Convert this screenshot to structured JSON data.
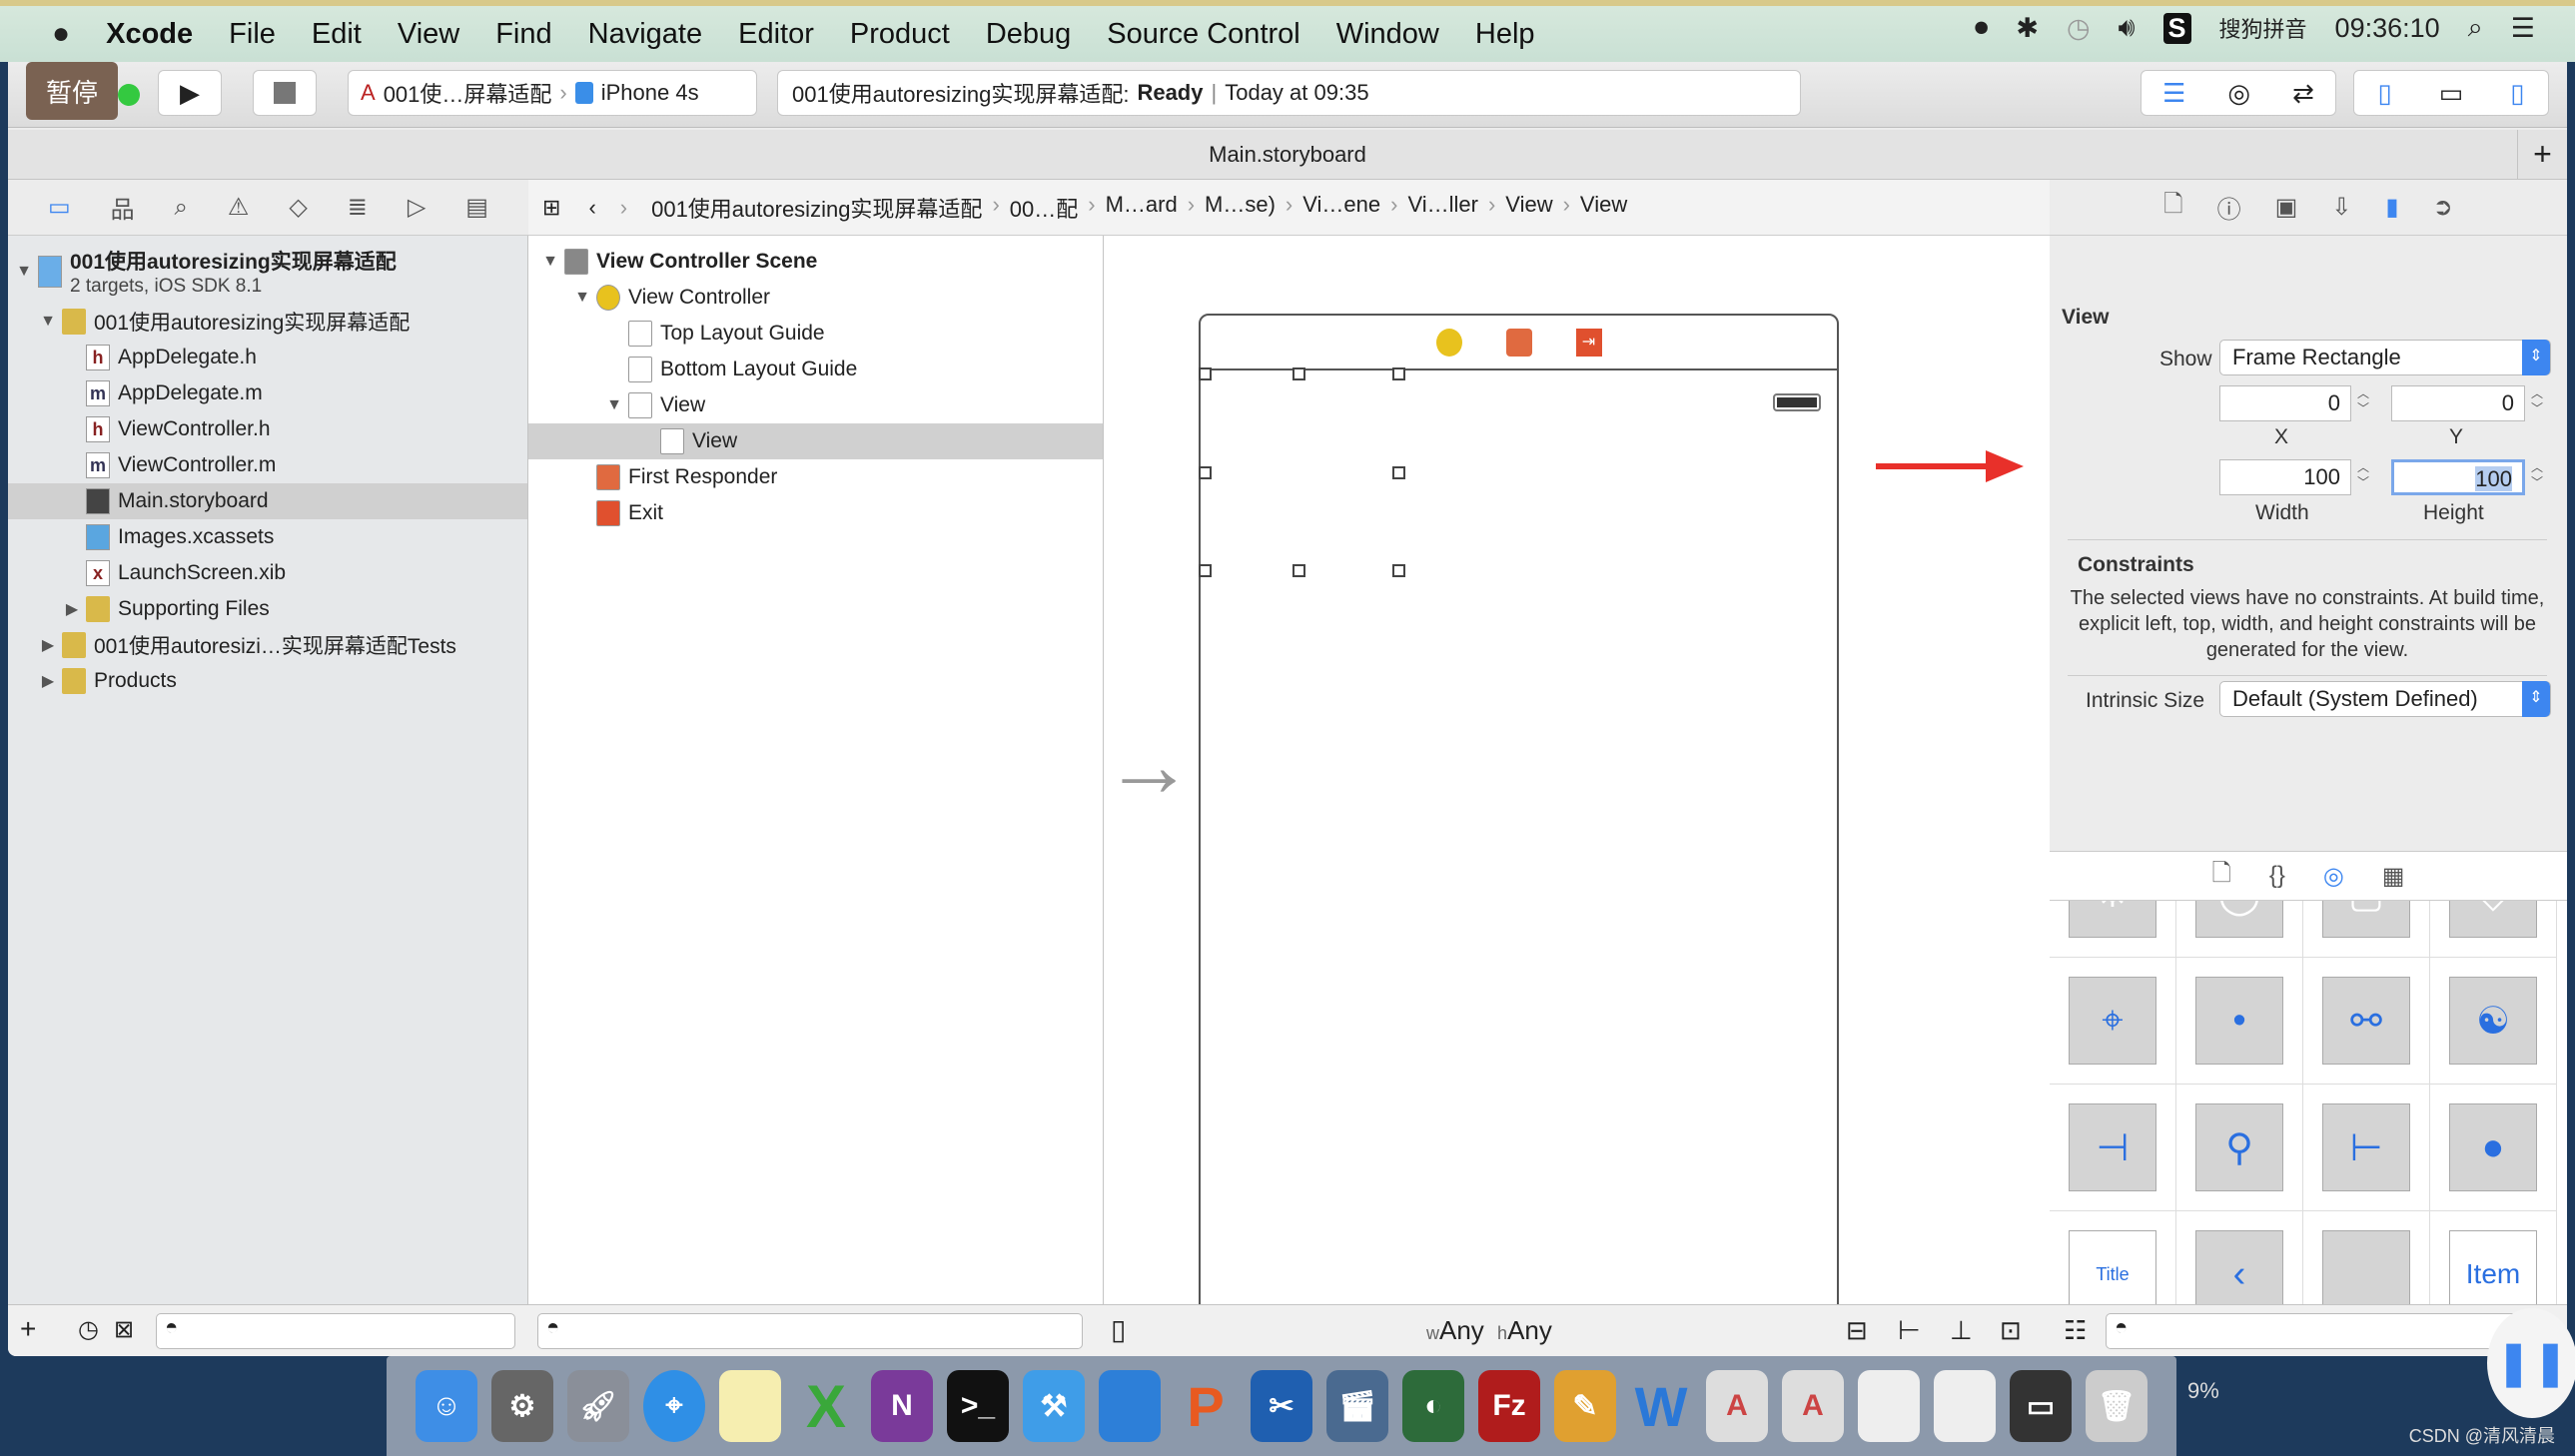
{
  "menubar": {
    "apple": "",
    "items": [
      "Xcode",
      "File",
      "Edit",
      "View",
      "Find",
      "Navigate",
      "Editor",
      "Product",
      "Debug",
      "Source Control",
      "Window",
      "Help"
    ],
    "input_method": "搜狗拼音",
    "clock": "09:36:10"
  },
  "toolbar": {
    "pause_label": "暂停",
    "scheme": "001使…屏幕适配",
    "device": "iPhone 4s",
    "activity_project": "001使用autoresizing实现屏幕适配:",
    "activity_status": "Ready",
    "activity_time": "Today at 09:35"
  },
  "tab": {
    "title": "Main.storyboard"
  },
  "jumpbar": [
    "001使用autoresizing实现屏幕适配",
    "00…配",
    "M…ard",
    "M…se)",
    "Vi…ene",
    "Vi…ller",
    "View",
    "View"
  ],
  "navigator": {
    "project": {
      "name": "001使用autoresizing实现屏幕适配",
      "subtitle": "2 targets, iOS SDK 8.1"
    },
    "items": [
      {
        "label": "001使用autoresizing实现屏幕适配",
        "type": "folder",
        "level": 1,
        "disclosure": "open"
      },
      {
        "label": "AppDelegate.h",
        "type": "h",
        "level": 2
      },
      {
        "label": "AppDelegate.m",
        "type": "m",
        "level": 2
      },
      {
        "label": "ViewController.h",
        "type": "h",
        "level": 2
      },
      {
        "label": "ViewController.m",
        "type": "m",
        "level": 2
      },
      {
        "label": "Main.storyboard",
        "type": "storyboard",
        "level": 2,
        "selected": true
      },
      {
        "label": "Images.xcassets",
        "type": "assets",
        "level": 2
      },
      {
        "label": "LaunchScreen.xib",
        "type": "xib",
        "level": 2
      },
      {
        "label": "Supporting Files",
        "type": "folder",
        "level": 2,
        "disclosure": "closed"
      },
      {
        "label": "001使用autoresizi…实现屏幕适配Tests",
        "type": "folder",
        "level": 1,
        "disclosure": "closed"
      },
      {
        "label": "Products",
        "type": "folder",
        "level": 1,
        "disclosure": "closed"
      }
    ]
  },
  "outline": {
    "items": [
      {
        "label": "View Controller Scene",
        "level": 0,
        "disclosure": "open",
        "bold": true,
        "icon": "scene"
      },
      {
        "label": "View Controller",
        "level": 1,
        "disclosure": "open",
        "icon": "viewcontroller"
      },
      {
        "label": "Top Layout Guide",
        "level": 2,
        "icon": "guide"
      },
      {
        "label": "Bottom Layout Guide",
        "level": 2,
        "icon": "guide"
      },
      {
        "label": "View",
        "level": 2,
        "disclosure": "open",
        "icon": "view"
      },
      {
        "label": "View",
        "level": 3,
        "icon": "view",
        "selected": true
      },
      {
        "label": "First Responder",
        "level": 1,
        "icon": "firstresponder"
      },
      {
        "label": "Exit",
        "level": 1,
        "icon": "exit"
      }
    ]
  },
  "canvas": {
    "size_class_w": "Any",
    "size_class_h": "Any",
    "w_prefix": "w",
    "h_prefix": "h"
  },
  "inspector": {
    "section": "View",
    "show_label": "Show",
    "show_value": "Frame Rectangle",
    "x": "0",
    "y": "0",
    "width": "100",
    "height": "100",
    "x_label": "X",
    "y_label": "Y",
    "width_label": "Width",
    "height_label": "Height",
    "constraints_title": "Constraints",
    "constraints_text": "The selected views have no constraints. At build time, explicit left, top, width, and height constraints will be generated for the view.",
    "intrinsic_label": "Intrinsic Size",
    "intrinsic_value": "Default (System Defined)"
  },
  "library": {
    "title_tile": "Title",
    "item_tile": "Item"
  },
  "dock": {
    "zoom_percent": "9%"
  },
  "watermark": "CSDN @清风清晨",
  "colors": {
    "accent": "#3d86f0",
    "annotation_arrow": "#e8302a",
    "pause_bg": "#7a6252"
  }
}
